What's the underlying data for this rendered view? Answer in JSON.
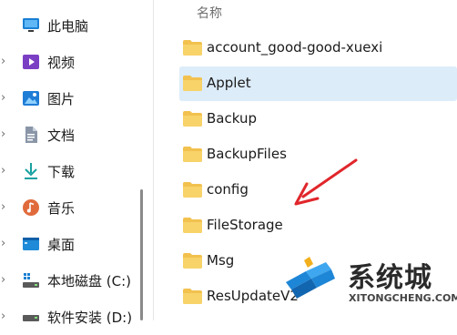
{
  "navigation": {
    "items": [
      {
        "label": "此电脑",
        "icon": "pc-icon",
        "expanded": true
      },
      {
        "label": "视频",
        "icon": "video-icon"
      },
      {
        "label": "图片",
        "icon": "pictures-icon"
      },
      {
        "label": "文档",
        "icon": "documents-icon"
      },
      {
        "label": "下载",
        "icon": "downloads-icon"
      },
      {
        "label": "音乐",
        "icon": "music-icon"
      },
      {
        "label": "桌面",
        "icon": "desktop-icon"
      },
      {
        "label": "本地磁盘 (C:)",
        "icon": "drive-icon"
      },
      {
        "label": "软件安装 (D:)",
        "icon": "drive-icon"
      }
    ]
  },
  "file_list": {
    "column_header": "名称",
    "items": [
      {
        "name": "account_good-good-xuexi",
        "type": "folder"
      },
      {
        "name": "Applet",
        "type": "folder",
        "selected": true
      },
      {
        "name": "Backup",
        "type": "folder"
      },
      {
        "name": "BackupFiles",
        "type": "folder"
      },
      {
        "name": "config",
        "type": "folder"
      },
      {
        "name": "FileStorage",
        "type": "folder"
      },
      {
        "name": "Msg",
        "type": "folder"
      },
      {
        "name": "ResUpdateV2",
        "type": "folder"
      }
    ]
  },
  "colors": {
    "folder": "#f2c14e",
    "selection": "#dcecf9",
    "arrow": "#e0262b",
    "watermark_blue": "#1e86d6"
  },
  "watermark": {
    "name": "系统城",
    "url": "XITONGCHENG.COM"
  }
}
